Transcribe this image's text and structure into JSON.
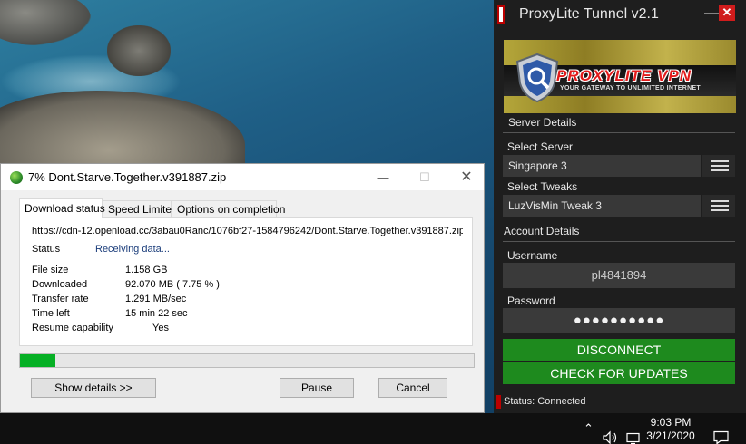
{
  "download_window": {
    "title": "7% Dont.Starve.Together.v391887.zip",
    "minimize": "—",
    "maximize": "☐",
    "close": "✕",
    "tabs": [
      "Download status",
      "Speed Limiter",
      "Options on completion"
    ],
    "active_tab": "Download status",
    "url": "https://cdn-12.openload.cc/3abau0Ranc/1076bf27-1584796242/Dont.Starve.Together.v391887.zip",
    "status_label": "Status",
    "status_value": "Receiving data...",
    "details": [
      {
        "label": "File size",
        "value": "1.158  GB"
      },
      {
        "label": "Downloaded",
        "value": "92.070  MB  ( 7.75 % )"
      },
      {
        "label": "Transfer rate",
        "value": "1.291  MB/sec"
      },
      {
        "label": "Time left",
        "value": "15 min 22 sec"
      },
      {
        "label": "Resume capability",
        "value": "Yes"
      }
    ],
    "progress_percent": 7.75,
    "buttons": {
      "details": "Show details >>",
      "pause": "Pause",
      "cancel": "Cancel"
    }
  },
  "proxylite": {
    "title": "ProxyLite Tunnel v2.1",
    "minimize": "—",
    "close": "✕",
    "banner_brand": "PROXYLITE VPN",
    "banner_tagline": "YOUR GATEWAY TO UNLIMITED INTERNET",
    "server_details_heading": "Server Details",
    "select_server_label": "Select Server",
    "select_server_value": "Singapore 3",
    "select_tweaks_label": "Select Tweaks",
    "select_tweaks_value": "LuzVisMin Tweak 3",
    "account_details_heading": "Account Details",
    "username_label": "Username",
    "username_value": "pl4841894",
    "password_label": "Password",
    "password_value": "●●●●●●●●●●",
    "disconnect_button": "DISCONNECT",
    "check_updates_button": "CHECK FOR UPDATES",
    "status_text": "Status: Connected",
    "accent_green": "#1e8a1e",
    "accent_red": "#d01c1c"
  },
  "taskbar": {
    "time": "9:03 PM",
    "date": "3/21/2020"
  }
}
